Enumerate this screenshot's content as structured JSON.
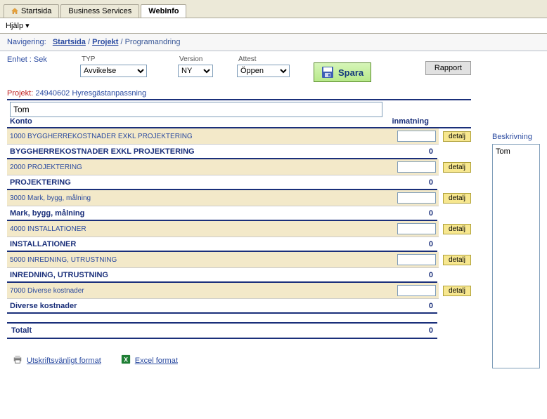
{
  "tabs": [
    {
      "label": "Startsida"
    },
    {
      "label": "Business Services"
    },
    {
      "label": "WebInfo"
    }
  ],
  "menu": {
    "help": "Hjälp"
  },
  "breadcrumb": {
    "label": "Navigering:",
    "a": "Startsida",
    "b": "Projekt",
    "c": "Programandring"
  },
  "enhet": "Enhet : Sek",
  "controls": {
    "typ_label": "TYP",
    "typ_value": "Avvikelse",
    "ver_label": "Version",
    "ver_value": "NY",
    "att_label": "Attest",
    "att_value": "Öppen",
    "spara": "Spara",
    "rapport": "Rapport"
  },
  "projekt": {
    "label": "Projekt:",
    "value": "24940602 Hyresgästanpassning"
  },
  "search_value": "Tom",
  "headers": {
    "konto": "Konto",
    "inmatning": "inmatning"
  },
  "rows": [
    {
      "code": "1000 BYGGHERREKOSTNADER EXKL PROJEKTERING",
      "sum_label": "BYGGHERREKOSTNADER EXKL PROJEKTERING",
      "sum_value": "0"
    },
    {
      "code": "2000 PROJEKTERING",
      "sum_label": "PROJEKTERING",
      "sum_value": "0"
    },
    {
      "code": "3000 Mark, bygg, målning",
      "sum_label": "Mark, bygg, målning",
      "sum_value": "0"
    },
    {
      "code": "4000 INSTALLATIONER",
      "sum_label": "INSTALLATIONER",
      "sum_value": "0"
    },
    {
      "code": "5000 INREDNING, UTRUSTNING",
      "sum_label": "INREDNING, UTRUSTNING",
      "sum_value": "0"
    },
    {
      "code": "7000 Diverse kostnader",
      "sum_label": "Diverse kostnader",
      "sum_value": "0"
    }
  ],
  "detalj_label": "detalj",
  "total": {
    "label": "Totalt",
    "value": "0"
  },
  "export": {
    "print": "Utskriftsvänligt format",
    "excel": "Excel format"
  },
  "desc": {
    "label": "Beskrivning",
    "value": "Tom"
  }
}
